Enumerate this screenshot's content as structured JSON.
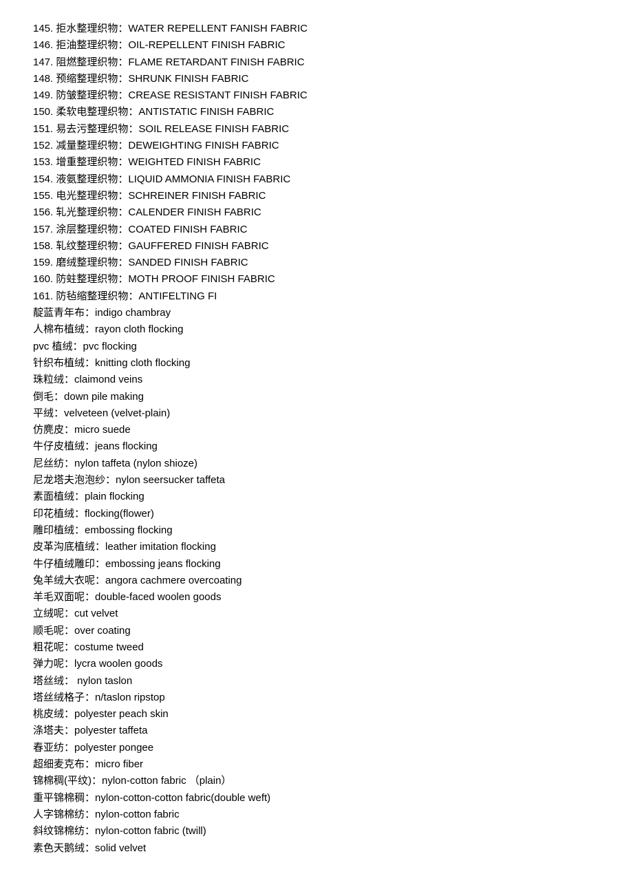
{
  "numbered": [
    {
      "n": "145.",
      "cn": "拒水整理织物：",
      "en": "WATER REPELLENT FANISH FABRIC"
    },
    {
      "n": "146.",
      "cn": "拒油整理织物：",
      "en": "OIL-REPELLENT FINISH FABRIC"
    },
    {
      "n": "147.",
      "cn": "阻燃整理织物：",
      "en": "FLAME RETARDANT FINISH FABRIC"
    },
    {
      "n": "148.",
      "cn": "预缩整理织物：",
      "en": "SHRUNK FINISH FABRIC"
    },
    {
      "n": "149.",
      "cn": "防皱整理织物：",
      "en": "CREASE RESISTANT FINISH FABRIC"
    },
    {
      "n": "150.",
      "cn": "柔软电整理织物：",
      "en": "ANTISTATIC FINISH FABRIC"
    },
    {
      "n": "151.",
      "cn": "易去污整理织物：",
      "en": "SOIL RELEASE FINISH FABRIC"
    },
    {
      "n": "152.",
      "cn": "减量整理织物：",
      "en": "DEWEIGHTING FINISH FABRIC"
    },
    {
      "n": "153.",
      "cn": "增重整理织物：",
      "en": "WEIGHTED FINISH FABRIC"
    },
    {
      "n": "154.",
      "cn": "液氨整理织物：",
      "en": "LIQUID AMMONIA FINISH FABRIC"
    },
    {
      "n": "155.",
      "cn": "电光整理织物：",
      "en": "SCHREINER FINISH FABRIC"
    },
    {
      "n": "156.",
      "cn": "轧光整理织物：",
      "en": "CALENDER FINISH FABRIC"
    },
    {
      "n": "157.",
      "cn": "涂层整理织物：",
      "en": "COATED FINISH FABRIC"
    },
    {
      "n": "158.",
      "cn": "轧纹整理织物：",
      "en": "GAUFFERED FINISH FABRIC"
    },
    {
      "n": "159.",
      "cn": "磨绒整理织物：",
      "en": "SANDED FINISH FABRIC"
    },
    {
      "n": "160.",
      "cn": "防蛀整理织物：",
      "en": "MOTH PROOF FINISH FABRIC"
    },
    {
      "n": "161.",
      "cn": "防毡缩整理织物：",
      "en": "ANTIFELTING FI"
    }
  ],
  "terms": [
    {
      "cn": "靛蓝青年布：",
      "en": "indigo chambray"
    },
    {
      "cn": "人棉布植绒：",
      "en": "rayon cloth flocking"
    },
    {
      "cn": "pvc 植绒：",
      "en": "pvc flocking"
    },
    {
      "cn": "针织布植绒：",
      "en": "knitting cloth flocking"
    },
    {
      "cn": "珠粒绒：",
      "en": "claimond veins"
    },
    {
      "cn": "倒毛：",
      "en": "down pile making"
    },
    {
      "cn": "平绒：",
      "en": "velveteen (velvet-plain)"
    },
    {
      "cn": "仿麂皮：",
      "en": "micro suede"
    },
    {
      "cn": "牛仔皮植绒：",
      "en": "jeans flocking"
    },
    {
      "cn": "尼丝纺：",
      "en": "nylon taffeta (nylon shioze)"
    },
    {
      "cn": "尼龙塔夫泡泡纱：",
      "en": "nylon seersucker taffeta"
    },
    {
      "cn": "素面植绒：",
      "en": "plain flocking"
    },
    {
      "cn": "印花植绒：",
      "en": "flocking(flower)"
    },
    {
      "cn": "雕印植绒：",
      "en": "embossing flocking"
    },
    {
      "cn": "皮革沟底植绒：",
      "en": "leather imitation flocking"
    },
    {
      "cn": "牛仔植绒雕印：",
      "en": "embossing jeans flocking"
    },
    {
      "cn": "兔羊绒大衣呢：",
      "en": "angora cachmere overcoating"
    },
    {
      "cn": "羊毛双面呢：",
      "en": "double-faced woolen goods"
    },
    {
      "cn": "立绒呢：",
      "en": "cut velvet"
    },
    {
      "cn": "顺毛呢：",
      "en": "over coating"
    },
    {
      "cn": "粗花呢：",
      "en": "costume tweed"
    },
    {
      "cn": "弹力呢：",
      "en": "lycra woolen goods"
    },
    {
      "cn": "塔丝绒： ",
      "en": " nylon taslon"
    },
    {
      "cn": "塔丝绒格子：",
      "en": "n/taslon ripstop"
    },
    {
      "cn": "桃皮绒：",
      "en": "polyester peach skin"
    },
    {
      "cn": "涤塔夫：",
      "en": "polyester taffeta"
    },
    {
      "cn": "春亚纺：",
      "en": "polyester pongee"
    },
    {
      "cn": "超细麦克布：",
      "en": "micro fiber"
    },
    {
      "cn": "锦棉稠(平纹)：",
      "en": "nylon-cotton fabric （plain）"
    },
    {
      "cn": "重平锦棉稠：",
      "en": "nylon-cotton-cotton fabric(double weft)"
    },
    {
      "cn": "人字锦棉纺：",
      "en": "nylon-cotton fabric"
    },
    {
      "cn": "斜纹锦棉纺：",
      "en": "nylon-cotton fabric (twill)"
    },
    {
      "cn": "素色天鹅绒：",
      "en": "solid velvet"
    }
  ]
}
